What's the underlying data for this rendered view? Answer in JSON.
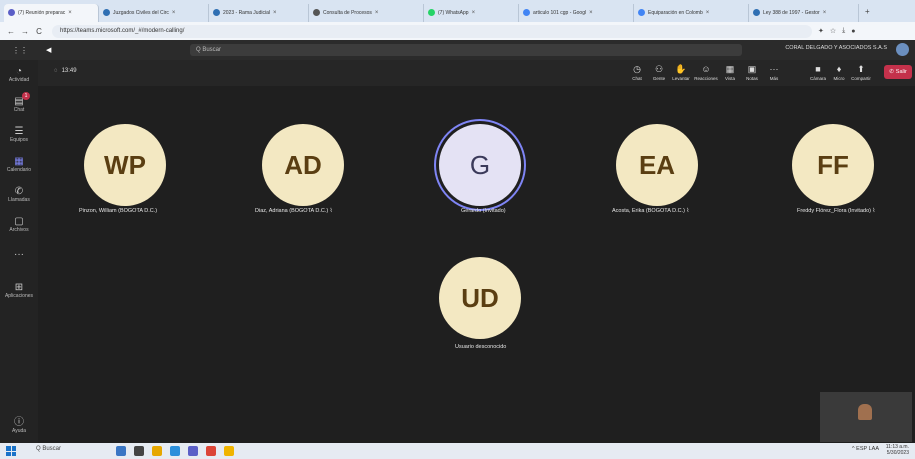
{
  "browser": {
    "tabs": [
      {
        "label": "(7) Reunión preparac",
        "color": "#5b5fc7"
      },
      {
        "label": "Juzgados Civiles del Circ",
        "color": "#2f6fb3"
      },
      {
        "label": "2023 - Rama Judicial",
        "color": "#2f6fb3"
      },
      {
        "label": "Consulta de Procesos",
        "color": "#555555"
      },
      {
        "label": "(7) WhatsApp",
        "color": "#25d366"
      },
      {
        "label": "articulo 101 cgp - Googl",
        "color": "#4285f4"
      },
      {
        "label": "Equiparación en Colomb",
        "color": "#4285f4"
      },
      {
        "label": "Ley 388 de 1997 - Gestor",
        "color": "#2f6fb3"
      }
    ],
    "url": "https://teams.microsoft.com/_#/modern-calling/",
    "new_tab": "+"
  },
  "teams": {
    "search_placeholder": "Q Buscar",
    "org_name": "CORAL DELGADO Y ASOCIADOS S.A.S",
    "timer": "13:49",
    "rail": [
      {
        "icon": "◔",
        "label": "Actividad",
        "name": "activity"
      },
      {
        "icon": "▤",
        "label": "Chat",
        "name": "chat"
      },
      {
        "icon": "☰",
        "label": "Equipos",
        "name": "teams"
      },
      {
        "icon": "▦",
        "label": "Calendario",
        "name": "calendar"
      },
      {
        "icon": "✆",
        "label": "Llamadas",
        "name": "calls"
      },
      {
        "icon": "▢",
        "label": "Archivos",
        "name": "files"
      },
      {
        "icon": "···",
        "label": "",
        "name": "more"
      },
      {
        "icon": "⊞",
        "label": "Aplicaciones",
        "name": "apps"
      }
    ],
    "help_label": "Ayuda",
    "chat_badge": "1",
    "controls": [
      {
        "icon": "◷",
        "label": "Chat",
        "name": "chat"
      },
      {
        "icon": "⚇",
        "label": "Gente",
        "name": "people"
      },
      {
        "icon": "✋",
        "label": "Levantar",
        "name": "raise-hand"
      },
      {
        "icon": "☺",
        "label": "Reacciones",
        "name": "reactions"
      },
      {
        "icon": "▦",
        "label": "Vista",
        "name": "view"
      },
      {
        "icon": "▣",
        "label": "Notas",
        "name": "notes"
      },
      {
        "icon": "···",
        "label": "Más",
        "name": "more"
      },
      {
        "icon": "■",
        "label": "Cámara",
        "name": "camera"
      },
      {
        "icon": "♦",
        "label": "Micro",
        "name": "mic"
      },
      {
        "icon": "⬆",
        "label": "Compartir",
        "name": "share"
      }
    ],
    "leave_label": "Salir",
    "participants": [
      {
        "initials": "WP",
        "name": "Pinzon, William (BOGOTA D.C.)",
        "speaking": false
      },
      {
        "initials": "AD",
        "name": "Diaz, Adriana (BOGOTA D.C.)",
        "speaking": false
      },
      {
        "initials": "G",
        "name": "Gerardo (Invitado)",
        "speaking": true
      },
      {
        "initials": "EA",
        "name": "Acosta, Erika (BOGOTA D.C.)",
        "speaking": false
      },
      {
        "initials": "FF",
        "name": "Freddy Flórez_Flora (Invitado)",
        "speaking": false
      },
      {
        "initials": "UD",
        "name": "Usuario desconocido",
        "speaking": false
      }
    ]
  },
  "taskbar": {
    "search": "Q Buscar",
    "tray": "^ ESP LAA",
    "time": "11:13 a.m.",
    "date": "5/30/2023"
  },
  "colors": {
    "accent": "#7f85f5",
    "leave": "#c4314b",
    "avatar_bg": "#f3e8c2"
  }
}
